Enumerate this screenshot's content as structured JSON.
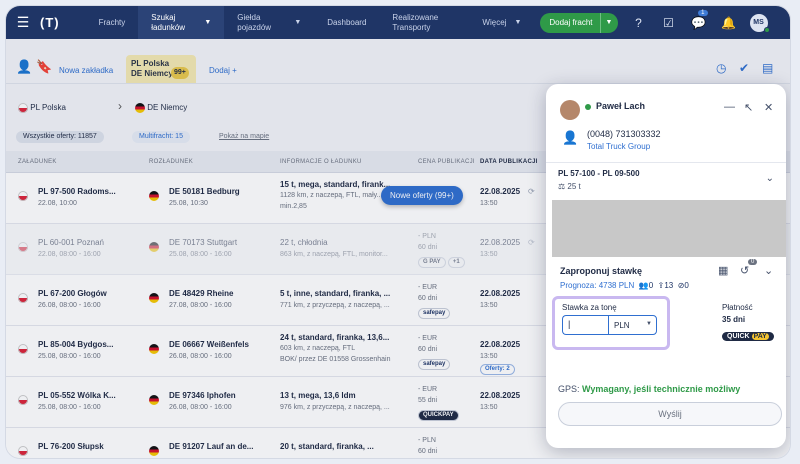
{
  "nav": {
    "logo": "(T)",
    "items": [
      {
        "label": "Frachty"
      },
      {
        "label": "Szukaj ładunków"
      },
      {
        "label": "Giełda pojazdów"
      },
      {
        "label": "Dashboard"
      },
      {
        "label": "Realizowane Transporty"
      }
    ],
    "more_label": "Więcej",
    "add_button": "Dodaj fracht",
    "chat_badge": "1",
    "avatar": "MS"
  },
  "tabs": {
    "new_tab": "Nowa zakładka",
    "active_tab_line1": "PL Polska",
    "active_tab_line2": "DE Niemcy",
    "active_tab_count": "99+",
    "add": "Dodaj +"
  },
  "route": {
    "from": "PL Polska",
    "to": "DE Niemcy"
  },
  "filters": {
    "all": "Wszystkie oferty: 11857",
    "multi": "Multifracht: 15",
    "map": "Pokaż na mapie"
  },
  "table": {
    "headers": [
      "ZAŁADUNEK",
      "ROZŁADUNEK",
      "INFORMACJE O ŁADUNKU",
      "CENA PUBLIKACJI",
      "DATA PUBLIKACJI"
    ],
    "rows": [
      {
        "from": "PL 97-500 Radoms...",
        "from_date": "22.08, 10:00",
        "to": "DE 50181 Bedburg",
        "to_date": "25.08, 10:30",
        "info1": "15 t, mega, standard, firank...",
        "info2": "1128 km, z naczepą, FTL, mały...",
        "info3": "min.2,85",
        "price1": "",
        "price2": "",
        "tag": "",
        "pub": "22.08.2025",
        "pub_time": "13:50"
      },
      {
        "from": "PL 60-001 Poznań",
        "from_date": "22.08, 08:00 - 16:00",
        "to": "DE 70173 Stuttgart",
        "to_date": "25.08, 08:00 - 16:00",
        "info1": "22 t, chłodnia",
        "info2": "863 km, z naczepą, FTL, monitor...",
        "info3": "",
        "price1": "- PLN",
        "price2": "60 dni",
        "tag": "G PAY",
        "pub": "22.08.2025",
        "pub_time": "13:50"
      },
      {
        "from": "PL 67-200 Głogów",
        "from_date": "26.08, 08:00 - 16:00",
        "to": "DE 48429 Rheine",
        "to_date": "27.08, 08:00 - 16:00",
        "info1": "5 t, inne, standard, firanka, ...",
        "info2": "771 km, z przyczepą, z naczepą, ...",
        "info3": "",
        "price1": "- EUR",
        "price2": "60 dni",
        "tag": "safepay",
        "pub": "22.08.2025",
        "pub_time": "13:50"
      },
      {
        "from": "PL 85-004 Bydgos...",
        "from_date": "25.08, 08:00 - 16:00",
        "to": "DE 06667 Weißenfels",
        "to_date": "26.08, 08:00 - 16:00",
        "info1": "24 t, standard, firanka, 13,6...",
        "info2": "603 km, z naczepą, FTL",
        "info3": "BOK/ przez DE 01558 Grossenhain",
        "price1": "- EUR",
        "price2": "60 dni",
        "tag": "safepay",
        "pub": "22.08.2025",
        "pub_time": "13:50",
        "offers": "Oferty: 2"
      },
      {
        "from": "PL 05-552 Wólka K...",
        "from_date": "25.08, 08:00 - 16:00",
        "to": "DE 97346 Iphofen",
        "to_date": "26.08, 08:00 - 16:00",
        "info1": "13 t, mega, 13,6 ldm",
        "info2": "976 km, z przyczepą, z naczepą, ...",
        "info3": "",
        "price1": "- EUR",
        "price2": "55 dni",
        "tag": "QUICKPAY",
        "pub": "22.08.2025",
        "pub_time": "13:50"
      },
      {
        "from": "PL 76-200 Słupsk",
        "from_date": "",
        "to": "DE 91207 Lauf an de...",
        "to_date": "",
        "info1": "20 t, standard, firanka, ...",
        "info2": "",
        "info3": "",
        "price1": "- PLN",
        "price2": "60 dni",
        "tag": "",
        "pub": "",
        "pub_time": ""
      }
    ]
  },
  "new_offers": "Nowe oferty (99+)",
  "panel": {
    "name": "Paweł Lach",
    "phone": "(0048) 731303332",
    "company": "Total Truck Group",
    "route": "PL 57-100 - PL 09-500",
    "weight": "25 t",
    "propose": "Zaproponuj stawkę",
    "history_badge": "0",
    "forecast": "Prognoza: 4738 PLN",
    "stat1": "0",
    "stat2": "13",
    "stat3": "0",
    "rate_label": "Stawka za tonę",
    "currency": "PLN",
    "payment_label": "Płatność",
    "payment_days": "35 dni",
    "quickpay": "QUICK",
    "quickpay_pay": "PAY",
    "gps_prefix": "GPS:",
    "gps_value": "Wymagany, jeśli technicznie możliwy",
    "send": "Wyślij"
  }
}
